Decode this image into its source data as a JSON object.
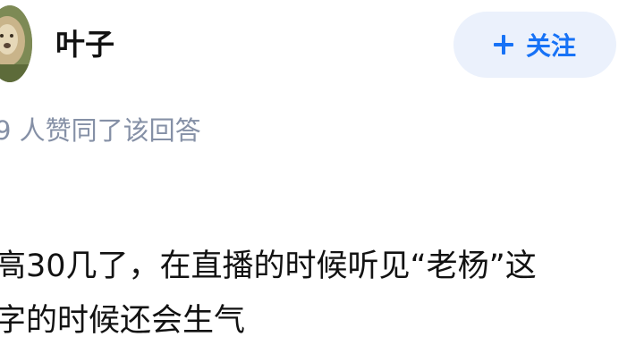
{
  "author": {
    "name": "叶子",
    "avatar_icon": "lion-avatar-icon"
  },
  "follow_button": {
    "icon": "plus-icon",
    "label": "关注",
    "color": "#1772f6",
    "background": "#ebf1fc"
  },
  "like_summary": "9 人赞同了该回答",
  "answer": {
    "lines": [
      "高30几了，在直播的时候听见“老杨”这",
      "字的时候还会生气"
    ]
  }
}
